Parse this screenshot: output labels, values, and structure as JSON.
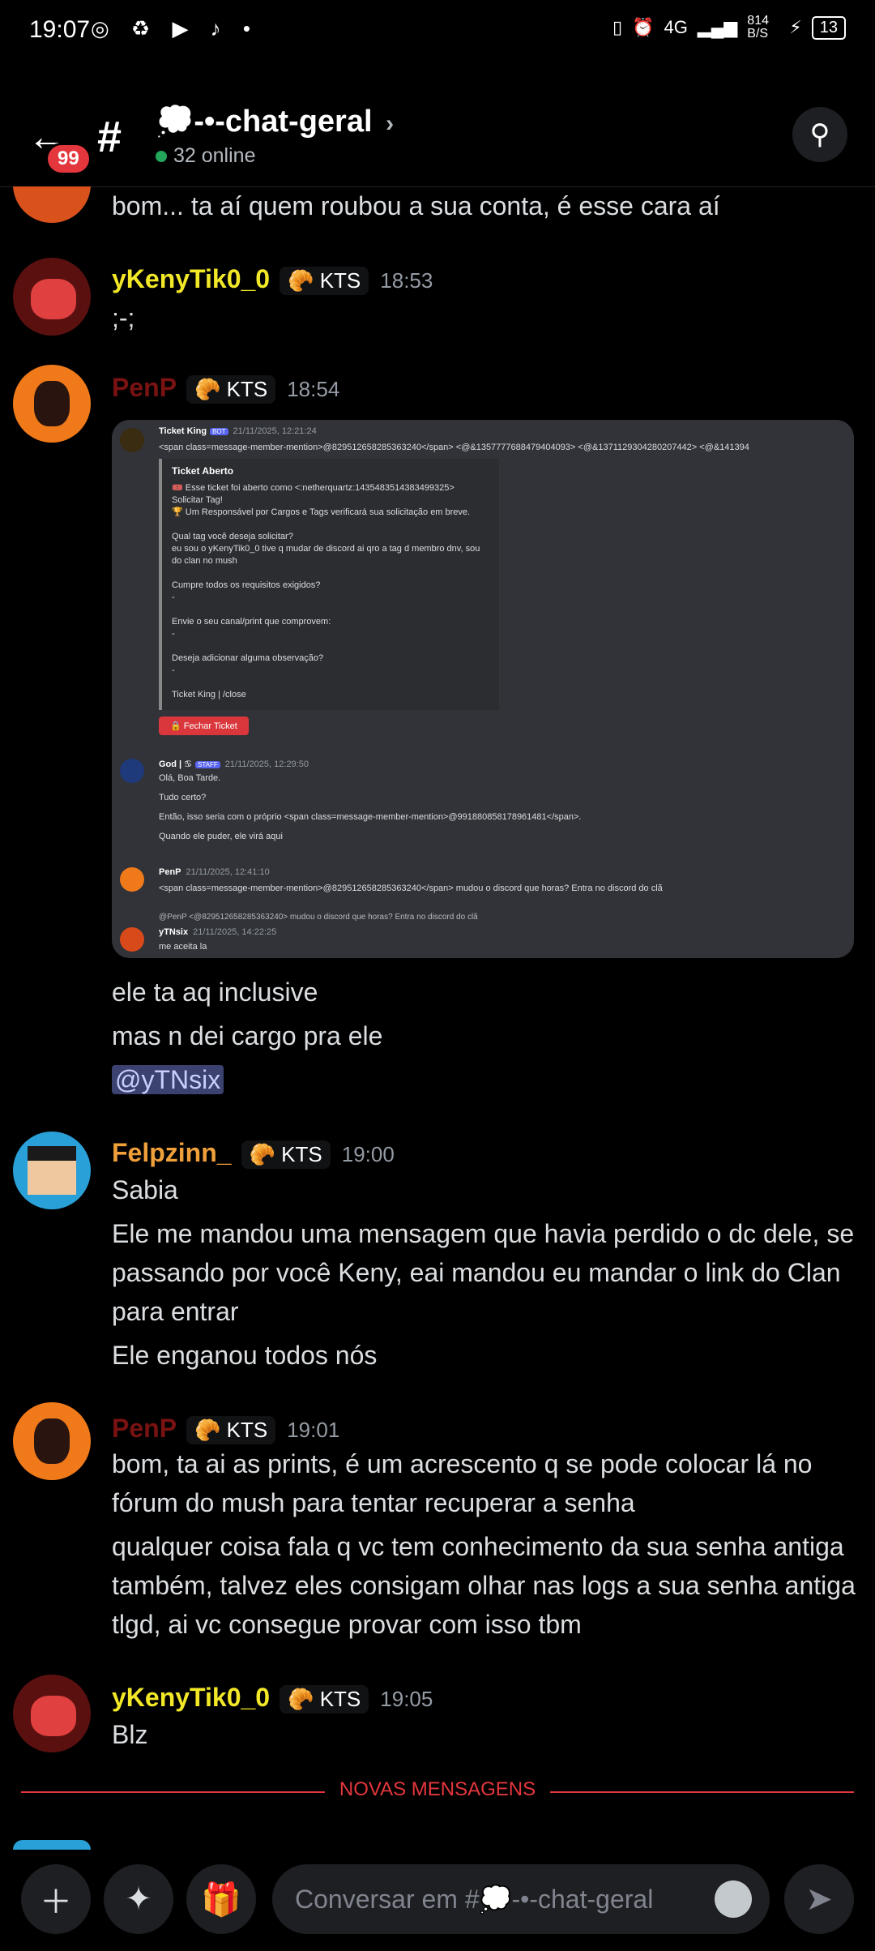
{
  "status_bar": {
    "time": "19:07",
    "speed": "814 B/S",
    "network": "4G",
    "battery": "13"
  },
  "header": {
    "unread_badge": "99",
    "channel_name": "💭-•-chat-geral",
    "online": "32 online"
  },
  "messages": [
    {
      "text": [
        "bom... ta aí quem roubou a sua conta, é esse cara aí"
      ]
    },
    {
      "author": "yKenyTik0_0",
      "tag": "KTS",
      "time": "18:53",
      "text": [
        ";-;"
      ]
    },
    {
      "author": "PenP",
      "tag": "KTS",
      "time": "18:54",
      "text": [
        "ele ta aq inclusive",
        "mas n dei cargo pra ele"
      ],
      "mention": "@yTNsix"
    },
    {
      "author": "Felpzinn_",
      "tag": "KTS",
      "time": "19:00",
      "text": [
        "Sabia",
        "Ele me mandou uma mensagem que havia perdido o dc dele, se passando por você Keny, eai mandou eu mandar o link do Clan para entrar",
        "Ele enganou todos nós"
      ]
    },
    {
      "author": "PenP",
      "tag": "KTS",
      "time": "19:01",
      "text": [
        "bom, ta ai as prints, é um acrescento q se pode colocar lá no fórum do mush para tentar recuperar a senha",
        "qualquer coisa fala q vc tem conhecimento da sua senha antiga também, talvez eles consigam olhar nas logs a sua senha antiga tlgd, ai vc consegue provar com isso tbm"
      ]
    },
    {
      "author": "yKenyTik0_0",
      "tag": "KTS",
      "time": "19:05",
      "text": [
        "Blz"
      ]
    }
  ],
  "screenshot": {
    "ticket_author": "Ticket King",
    "bot": "BOT",
    "ticket_time": "21/11/2025, 12:21:24",
    "ticket_line": "<span class=message-member-mention>@829512658285363240</span> <@&1357777688479404093> <@&1371129304280207442> <@&141394",
    "ticket_title": "Ticket Aberto",
    "ticket_body": [
      "🎟️ Esse ticket foi aberto como <:netherquartz:1435483514383499325>",
      "Solicitar Tag!",
      "🏆 Um Responsável por Cargos e Tags verificará sua solicitação em breve.",
      "",
      "Qual tag você deseja solicitar?",
      "eu sou o yKenyTik0_0 tive q mudar de discord ai qro a tag d membro dnv, sou do clan no mush",
      "",
      "Cumpre todos os requisitos exigidos?",
      "-",
      "",
      "Envie o seu canal/print que comprovem:",
      "-",
      "",
      "Deseja adicionar alguma observação?",
      "-",
      "",
      "Ticket King | /close"
    ],
    "close_btn": "🔒 Fechar Ticket",
    "god_name": "God | ♋",
    "staff": "STAFF",
    "god_time": "21/11/2025, 12:29:50",
    "god_lines": [
      "Olá, Boa Tarde.",
      "Tudo certo?",
      "Então, isso seria com o próprio <span class=message-member-mention>@991880858178961481</span>.",
      "Quando ele puder, ele virá aqui"
    ],
    "penp_name": "PenP",
    "penp_time": "21/11/2025, 12:41:10",
    "penp_line": "<span class=message-member-mention>@829512658285363240</span> mudou o discord que horas? Entra no discord do clã",
    "reply_line": "@PenP <@829512658285363240> mudou o discord que horas? Entra no discord do clã",
    "yt_name": "yTNsix",
    "yt_time": "21/11/2025, 14:22:25",
    "yt_line": "me aceita la"
  },
  "divider": "NOVAS MENSAGENS",
  "composer": {
    "placeholder": "Conversar em #💭-•-chat-geral"
  },
  "colors": {
    "ykeny": "#f2e827",
    "penp": "#7a1212",
    "felp": "#f0a03a",
    "new": "#e3363d"
  }
}
